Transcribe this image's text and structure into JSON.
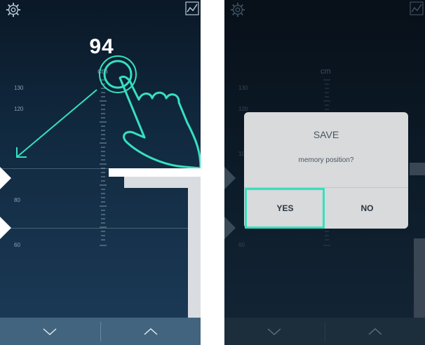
{
  "left_screen": {
    "height_value": "94",
    "unit": "cm",
    "scale_labels": [
      "130",
      "120",
      "80",
      "60"
    ],
    "icons": [
      "gear-icon",
      "graph-icon",
      "chevron-down-icon",
      "chevron-up-icon",
      "pointing-hand-icon",
      "arrow-icon"
    ]
  },
  "right_screen": {
    "unit": "cm",
    "scale_labels": [
      "130",
      "120",
      "10",
      "60"
    ],
    "dialog": {
      "title": "SAVE",
      "message": "memory position?",
      "yes_label": "YES",
      "no_label": "NO"
    }
  },
  "colors": {
    "highlight": "#36e0bf",
    "bottom_bar": "#42647e"
  }
}
